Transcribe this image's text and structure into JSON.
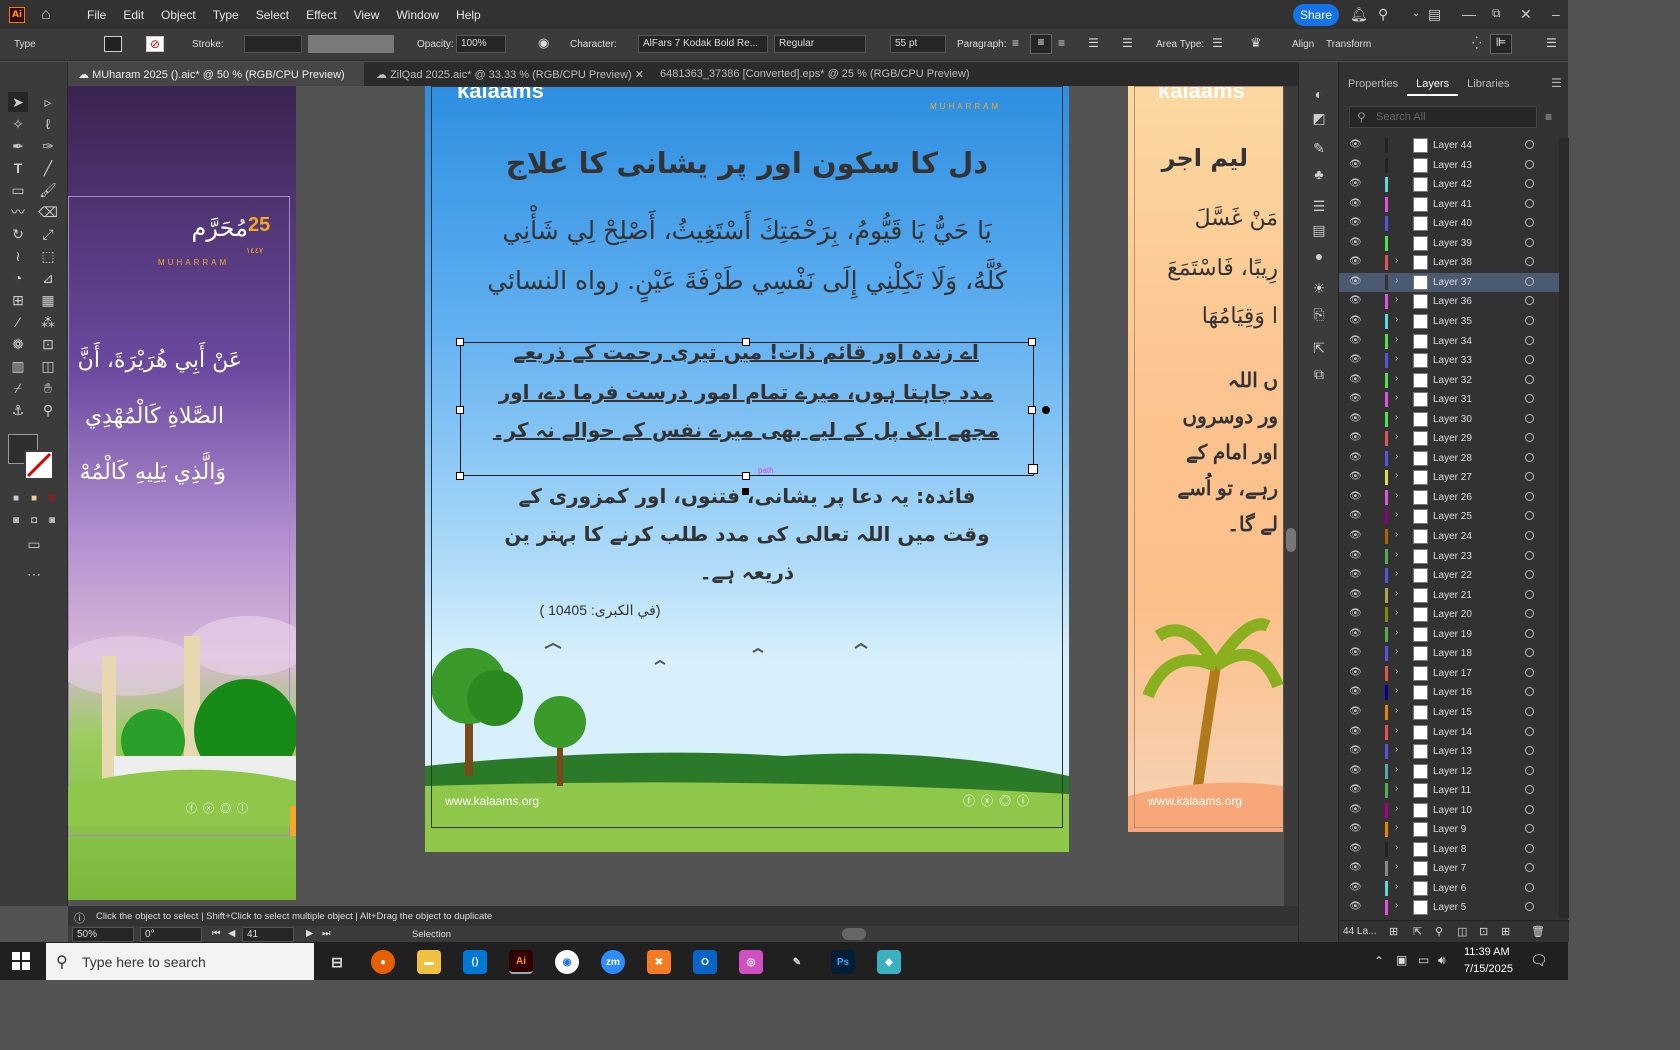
{
  "menubar": {
    "items": [
      "File",
      "Edit",
      "Object",
      "Type",
      "Select",
      "Effect",
      "View",
      "Window",
      "Help"
    ],
    "share": "Share",
    "logo": "Ai"
  },
  "control": {
    "type_label": "Type",
    "stroke_label": "Stroke:",
    "opacity_label": "Opacity:",
    "opacity_value": "100%",
    "character_label": "Character:",
    "font_name": "AlFars 7 Kodak Bold Re...",
    "font_style": "Regular",
    "font_size": "55 pt",
    "paragraph_label": "Paragraph:",
    "area_type_label": "Area Type:",
    "align_label": "Align",
    "transform_label": "Transform"
  },
  "tabs": [
    "MUharam 2025 ().aic* @ 50 % (RGB/CPU Preview)",
    "ZilQad 2025.aic* @ 33.33 % (RGB/CPU Preview)",
    "6481363_37386 [Converted].eps* @ 25 % (RGB/CPU Preview)"
  ],
  "left_art": {
    "date_num": "25",
    "date_ar": "مُحَرَّم",
    "date_en": "MUHARRAM",
    "year": "١٤٤٧",
    "l1": "عَنْ أَبِي هُرَيْرَةَ، أَنَّ",
    "l2": "الصَّلاةِ كَالْمُهْدِي",
    "l3": "وَالَّذِي يَلِيهِ كَالْمُهْ"
  },
  "center_art": {
    "brand": "kalaams",
    "muharram_en": "MUHARRAM",
    "title": "دل کا سکون اور پر یشانی کا علاج",
    "arabic1": "يَا حَيُّ يَا قَيُّومُ، بِرَحْمَتِكَ أَسْتَغِيثُ، أَصْلِحْ لِي شَأْنِي",
    "arabic2": "كُلَّهُ، وَلَا تَكِلْنِي إِلَى نَفْسِي طَرْفَةَ عَيْنٍ. رواه النسائي",
    "urdu1": "اے زندہ اور قائم ذات! میں تیری رحمت کے ذریعے",
    "urdu2": "مدد چاہتا ہوں، میرے تمام امور درست فرما دے، اور",
    "urdu3": "مجھے ایک پل کے لیے بھی میرے نفس کے حوالے نہ کر۔",
    "benefit1": "فائدہ: یہ دعا پر یشانی، فتنوں، اور کمزوری کے",
    "benefit2": "وقت میں اللہ تعالی کی مدد طلب کرنے کا بہتر ین",
    "benefit3": "ذریعہ ہے۔",
    "ref": "(في الكبرى: 10405 )",
    "website": "www.kalaams.org",
    "path_label": "path"
  },
  "right_art": {
    "brand": "kalaams",
    "title": "لیم اجر",
    "r1": "مَنْ غَسَّلَ",
    "r2": "رِيبًا، فَاسْتَمَعَ",
    "r3": "ا وَقِيَامُهَا",
    "u1": "ں اللہ",
    "u2": "ور دوسروں",
    "u3": "اور امام کے",
    "u4": "رہے، تو اُسے",
    "u5": "لے گا۔",
    "website": "www.kalaams.org"
  },
  "panel": {
    "tabs": [
      "Properties",
      "Layers",
      "Libraries"
    ],
    "search_placeholder": "Search All",
    "layers": [
      "Layer 44",
      "Layer 43",
      "Layer 42",
      "Layer 41",
      "Layer 40",
      "Layer 39",
      "Layer 38",
      "Layer 37",
      "Layer 36",
      "Layer 35",
      "Layer 34",
      "Layer 33",
      "Layer 32",
      "Layer 31",
      "Layer 30",
      "Layer 29",
      "Layer 28",
      "Layer 27",
      "Layer 26",
      "Layer 25",
      "Layer 24",
      "Layer 23",
      "Layer 22",
      "Layer 21",
      "Layer 20",
      "Layer 19",
      "Layer 18",
      "Layer 17",
      "Layer 16",
      "Layer 15",
      "Layer 14",
      "Layer 13",
      "Layer 12",
      "Layer 11",
      "Layer 10",
      "Layer 9",
      "Layer 8",
      "Layer 7",
      "Layer 6",
      "Layer 5"
    ],
    "layer_colors": [
      "#222",
      "#222",
      "#5dd",
      "#d5d",
      "#55d",
      "#5d5",
      "#d55",
      "#333",
      "#d5d",
      "#5dd",
      "#5d5",
      "#55d",
      "#5d5",
      "#d5d",
      "#5d5",
      "#d55",
      "#55d",
      "#dd5",
      "#d5d",
      "#808",
      "#a60",
      "#5a5",
      "#55d",
      "#aa5",
      "#880",
      "#5a5",
      "#55d",
      "#d55",
      "#008",
      "#d80",
      "#d55",
      "#55d",
      "#5aa",
      "#5a5",
      "#a08",
      "#d80",
      "#222",
      "#888",
      "#5dd",
      "#d5d"
    ],
    "selected": "Layer 37",
    "footer": "44 La..."
  },
  "status": {
    "hint": "Click the object to select | Shift+Click to select multiple object | Alt+Drag the object to duplicate",
    "zoom": "50%",
    "rotate": "0°",
    "artboard": "41",
    "tool": "Selection"
  },
  "taskbar": {
    "search": "Type here to search",
    "time": "11:39 AM",
    "date": "7/15/2025"
  }
}
